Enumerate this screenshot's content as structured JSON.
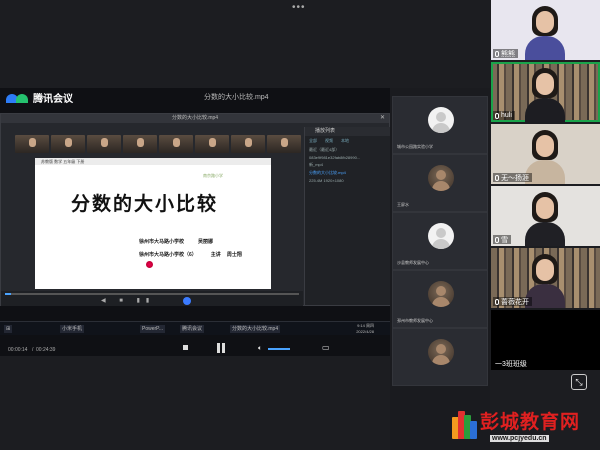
{
  "app": {
    "name": "腾讯会议",
    "badge": ""
  },
  "shared": {
    "file_title": "分数的大小比较.mp4",
    "player_title": "分数的大小比较.mp4",
    "slide_tab": "苏教版  数学  五年级  下册",
    "slide_title": "分数的大小比较",
    "slide_school_logo": "南京路小学",
    "slide_line1": {
      "org": "徐州市大马路小学校",
      "name": "吴丽娜"
    },
    "slide_line2": {
      "org": "徐州市大马路小学校（6）",
      "role": "主讲",
      "name": "周士翔"
    },
    "playlist": {
      "header": "播放列表",
      "tabs": [
        "全部",
        "视频",
        "本地"
      ],
      "rows": [
        "最近（最近4部）",
        "083e9f981e32fab8fb28990...",
        "新_mp4",
        "分数的大小比较.mp4",
        "225.4M  1920×1080"
      ],
      "active_row": 3
    },
    "player_progress": 0.02,
    "taskbar": {
      "items": [
        "小米手机",
        "PowerP...",
        "腾讯会议",
        "分数的大小比较.mp4"
      ],
      "time": "9:14 周四",
      "date": "2022/4/28"
    }
  },
  "controls": {
    "elapsed": "00:00:14",
    "total": "00:24:39",
    "progress": 0.01
  },
  "middle": {
    "tiles": [
      {
        "name": "城市公园路实验小学",
        "photo": false
      },
      {
        "name": "王屏水",
        "photo": true
      },
      {
        "name": "沙县教师发展中心",
        "photo": false
      },
      {
        "name": "邳州市教师发展中心",
        "photo": true
      },
      {
        "name": "",
        "photo": true
      }
    ]
  },
  "gallery": [
    {
      "name": "熊熊",
      "muted": false,
      "bg": "#e8e6ef",
      "shirt": "#4a4e9c"
    },
    {
      "name": "huli",
      "muted": false,
      "bg": "shelf",
      "shirt": "#1d1d22",
      "active": true
    },
    {
      "name": "无～扬涯",
      "muted": false,
      "bg": "#d9d2c8",
      "shirt": "#c7b59f"
    },
    {
      "name": "雪",
      "muted": false,
      "bg": "#e4e2df",
      "shirt": "#202025"
    },
    {
      "name": "蔷薇花开",
      "muted": false,
      "bg": "shelf",
      "shirt": "#3a2f40"
    },
    {
      "name": "一3班班级",
      "muted": false,
      "bg": "#000000",
      "shirt": ""
    }
  ],
  "watermark": {
    "brand": "彭城教育网",
    "url": "www.pcjyedu.cn"
  },
  "colors": {
    "active": "#1aa34a",
    "accent": "#3b7bff",
    "brand_red": "#e02020"
  }
}
